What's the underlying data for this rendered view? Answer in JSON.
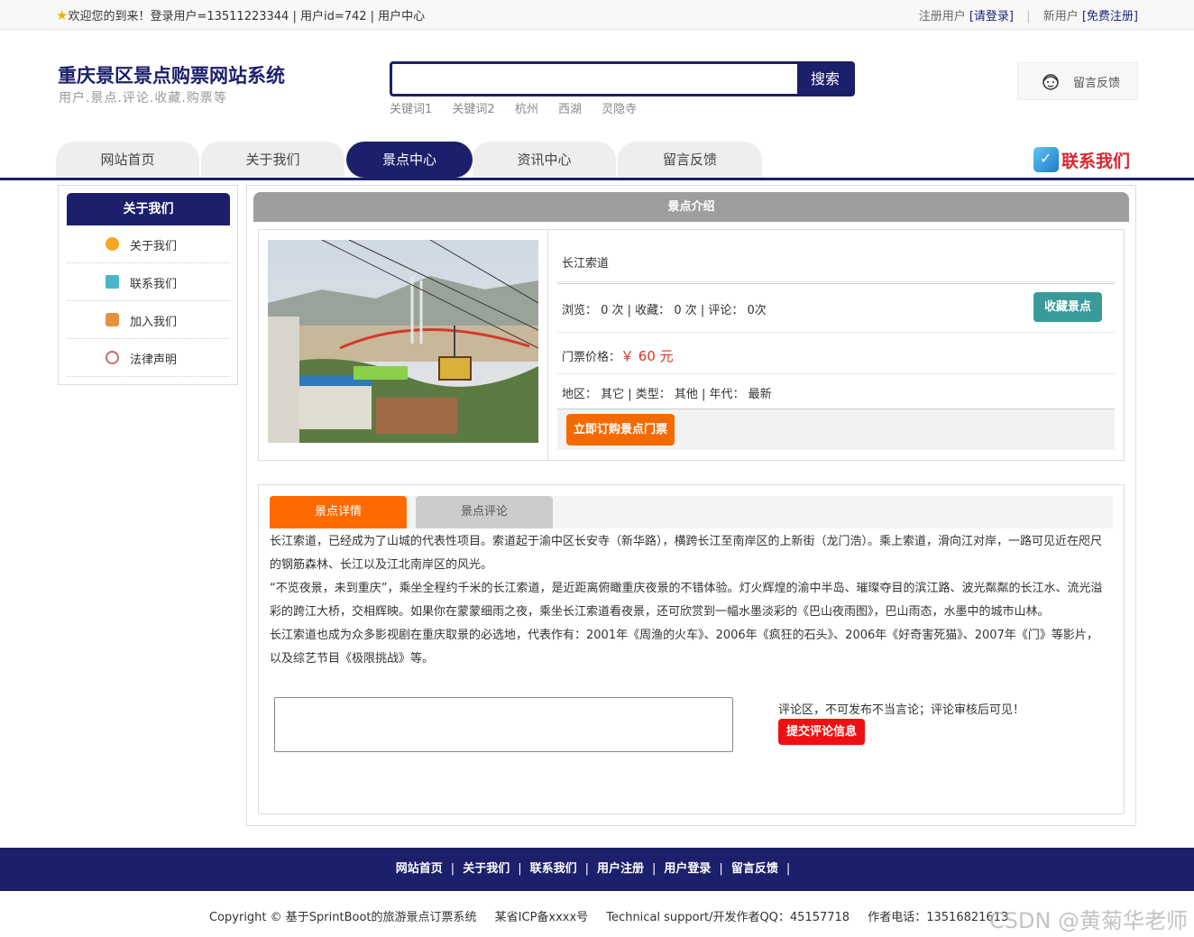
{
  "topbar": {
    "welcome": "欢迎您的到来！登录用户=13511223344 | 用户id=742 | 用户中心",
    "reg_user_label": "注册用户",
    "login_link": "[请登录]",
    "new_user_label": "新用户",
    "register_link": "[免费注册]"
  },
  "header": {
    "site_title": "重庆景区景点购票网站系统",
    "site_subtitle": "用户.景点.评论.收藏.购票等",
    "search_button": "搜索",
    "keywords": [
      "关键词1",
      "关键词2",
      "杭州",
      "西湖",
      "灵隐寺"
    ],
    "feedback_label": "留言反馈"
  },
  "nav": {
    "items": [
      "网站首页",
      "关于我们",
      "景点中心",
      "资讯中心",
      "留言反馈"
    ],
    "active_index": 2,
    "contact_label": "联系我们"
  },
  "sidebar": {
    "title": "关于我们",
    "items": [
      {
        "label": "关于我们",
        "icon": "coin-icon",
        "color": "#f5a623"
      },
      {
        "label": "联系我们",
        "icon": "clipboard-icon",
        "color": "#4ab6c9"
      },
      {
        "label": "加入我们",
        "icon": "lock-icon",
        "color": "#e88f3d"
      },
      {
        "label": "法律声明",
        "icon": "power-icon",
        "color": "#c86a6a"
      }
    ]
  },
  "panel": {
    "title": "景点介绍",
    "name": "长江索道",
    "stats": "浏览： 0 次    |    收藏： 0 次    |    评论： 0次",
    "favorite_button": "收藏景点",
    "price_label": "门票价格：",
    "price_value": "￥ 60 元",
    "meta": "地区： 其它 | 类型： 其他 | 年代： 最新",
    "buy_button": "立即订购景点门票"
  },
  "tabs": {
    "detail": "景点详情",
    "comments": "景点评论"
  },
  "description": [
    "长江索道，已经成为了山城的代表性项目。索道起于渝中区长安寺（新华路），横跨长江至南岸区的上新街（龙门浩）。乘上索道，滑向江对岸，一路可见近在咫尺的钢筋森林、长江以及江北南岸区的风光。",
    "“不览夜景，未到重庆”，乘坐全程约千米的长江索道，是近距离俯瞰重庆夜景的不错体验。灯火辉煌的渝中半岛、璀璨夺目的滨江路、波光粼粼的长江水、流光溢彩的跨江大桥，交相辉映。如果你在蒙蒙细雨之夜，乘坐长江索道看夜景，还可欣赏到一幅水墨淡彩的《巴山夜雨图》，巴山雨态，水墨中的城市山林。",
    "长江索道也成为众多影视剧在重庆取景的必选地，代表作有：2001年《周渔的火车》、2006年《疯狂的石头》、2006年《好奇害死猫》、2007年《门》等影片，以及综艺节目《极限挑战》等。"
  ],
  "comment": {
    "note": "评论区，不可发布不当言论；评论审核后可见！",
    "submit_button": "提交评论信息"
  },
  "footer": {
    "links": [
      "网站首页",
      "关于我们",
      "联系我们",
      "用户注册",
      "用户登录",
      "留言反馈"
    ],
    "copyright": "Copyright © 基于SprintBoot的旅游景点订票系统",
    "icp": "某省ICP备xxxx号",
    "support": "Technical support/开发作者QQ：45157718",
    "phone": "作者电话：13516821613",
    "watermark": "CSDN @黄菊华老师"
  },
  "colors": {
    "brand": "#1c1f6b",
    "accent_orange": "#f56a00",
    "teal": "#3a9a9a",
    "red": "#ee1111"
  }
}
